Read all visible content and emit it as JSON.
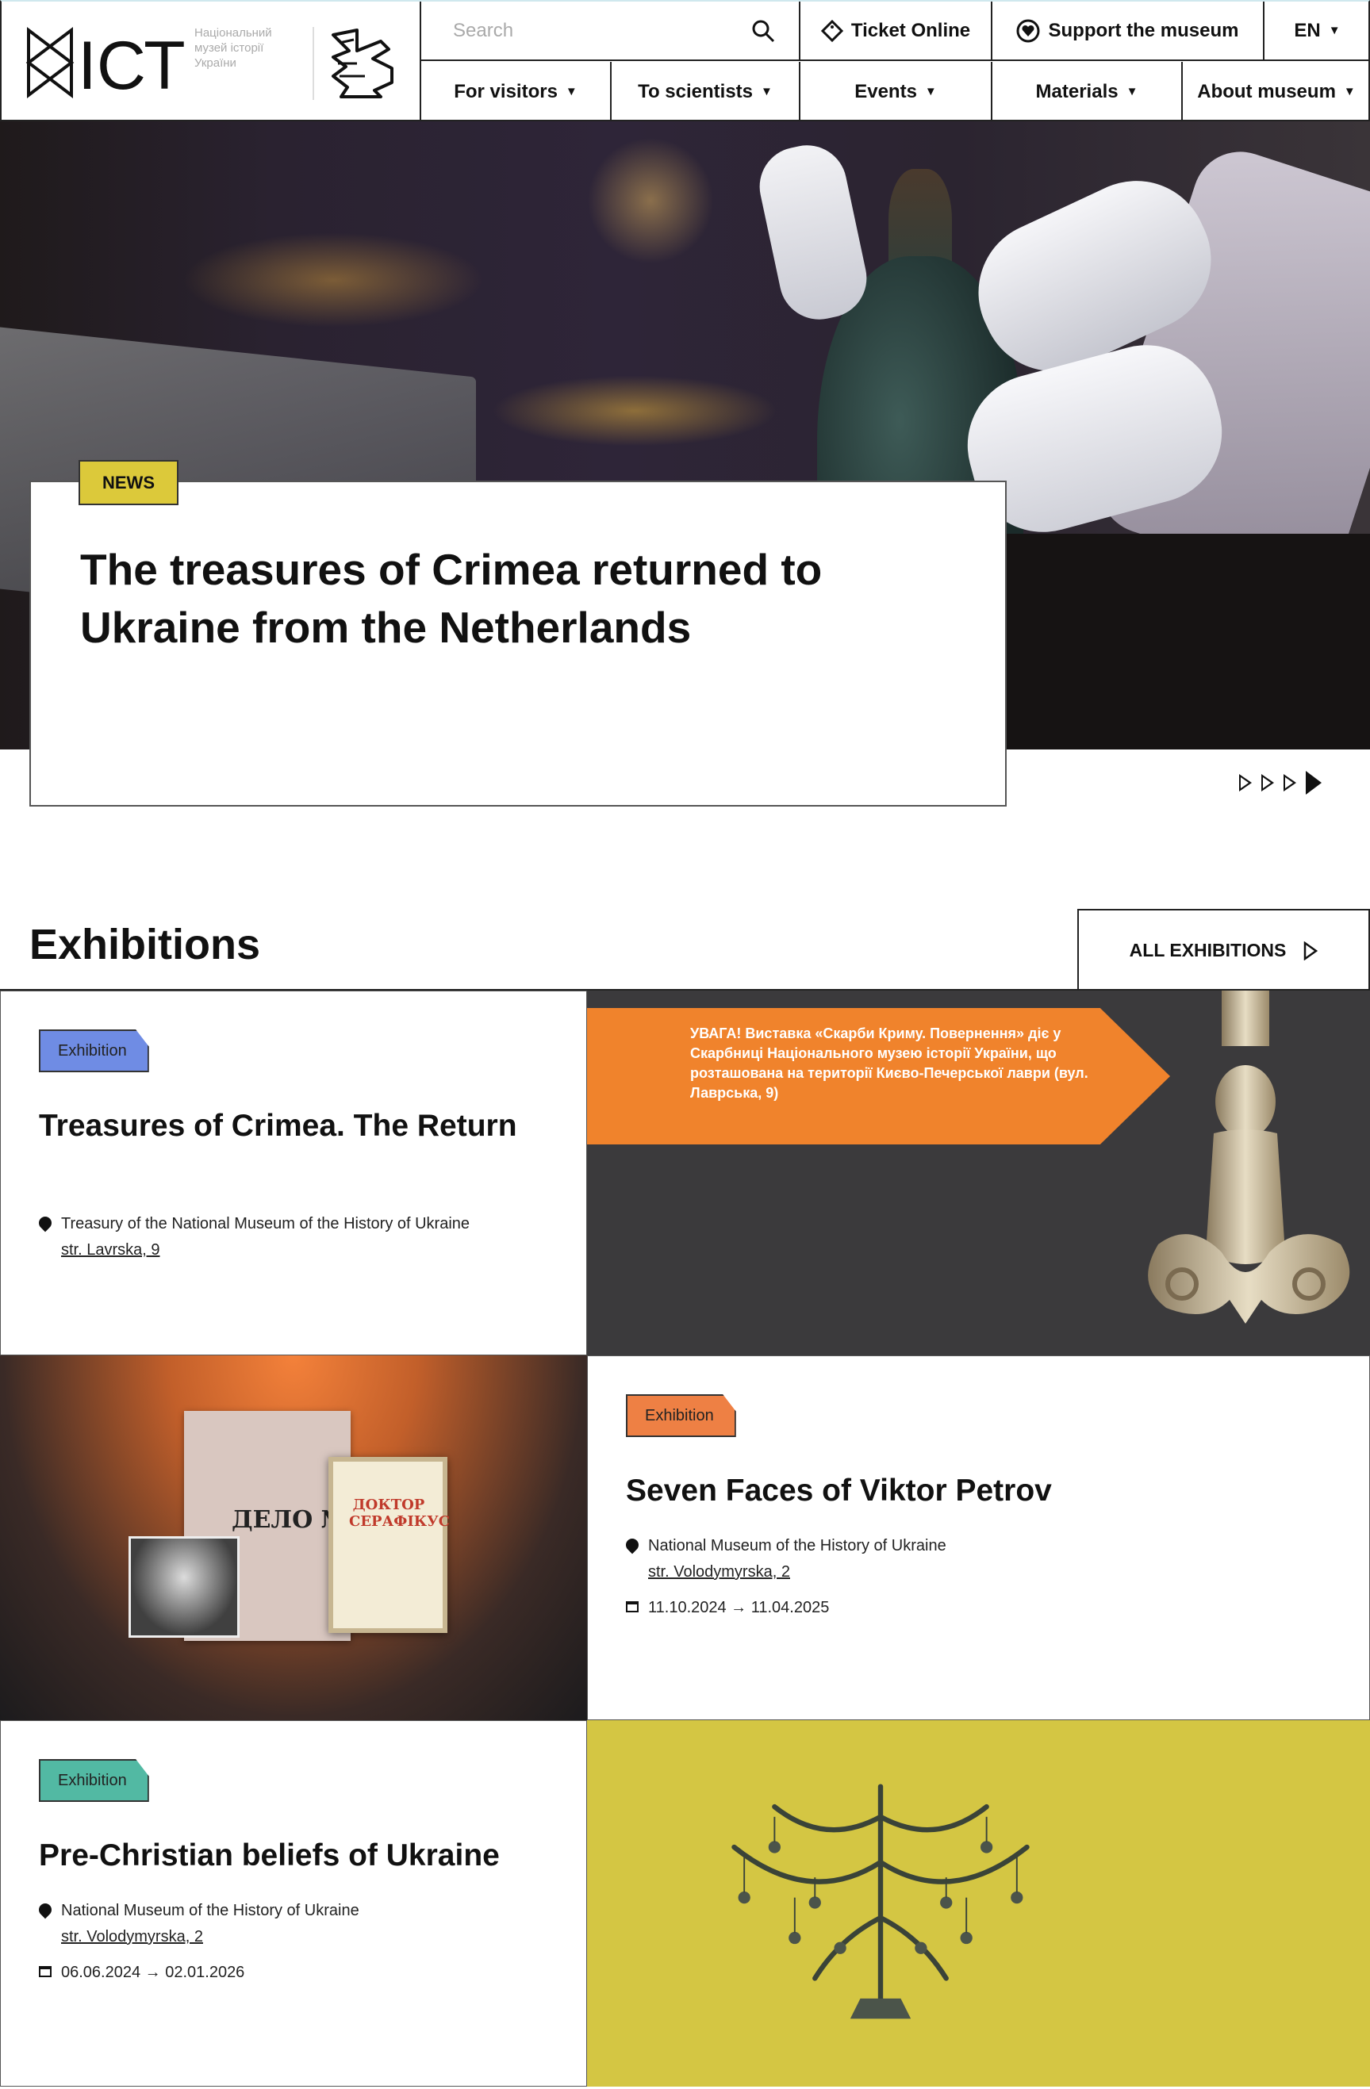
{
  "header": {
    "logo_text_lines": [
      "Національний",
      "музей історії",
      "України"
    ],
    "logo_wordmark": "ІСТ",
    "search_placeholder": "Search",
    "ticket_label": "Ticket Online",
    "support_label": "Support the museum",
    "lang_label": "EN",
    "nav": [
      "For visitors",
      "To scientists",
      "Events",
      "Materials",
      "About museum"
    ]
  },
  "hero": {
    "tag": "NEWS",
    "title": "The treasures of Crimea returned to Ukraine from the Netherlands",
    "slides_count": 4,
    "active_slide": 4
  },
  "exhibitions": {
    "heading": "Exhibitions",
    "all_button": "ALL EXHIBITIONS",
    "banner_text": "УВАГА! Виставка «Скарби Криму. Повернення» діє у Скарбниці Національного музею історії України, що розташована на території Києво-Печерської лаври (вул. Лаврська, 9)",
    "doc_paper_text": "ДЕЛО №",
    "doc_book_text": "ДОКТОР СЕРАФІКУС",
    "cards": [
      {
        "tag": "Exhibition",
        "tag_color": "#6f8ce4",
        "title": "Treasures of Crimea. The Return",
        "location": "Treasury of the National Museum of the History of Ukraine",
        "address": "str. Lavrska, 9"
      },
      {
        "tag": "Exhibition",
        "tag_color": "#ee8044",
        "title": "Seven Faces of Viktor Petrov",
        "location": "National Museum of the History of Ukraine",
        "address": "str. Volodymyrska, 2",
        "dates": "11.10.2024 → 11.04.2025"
      },
      {
        "tag": "Exhibition",
        "tag_color": "#52b9a3",
        "title": "Pre-Christian beliefs of Ukraine",
        "location": "National Museum of the History of Ukraine",
        "address": "str. Volodymyrska, 2",
        "dates": "06.06.2024 → 02.01.2026"
      }
    ]
  },
  "colors": {
    "news_tag": "#dcc93a",
    "banner": "#f0832c",
    "yellow_bg": "#d4c643"
  }
}
